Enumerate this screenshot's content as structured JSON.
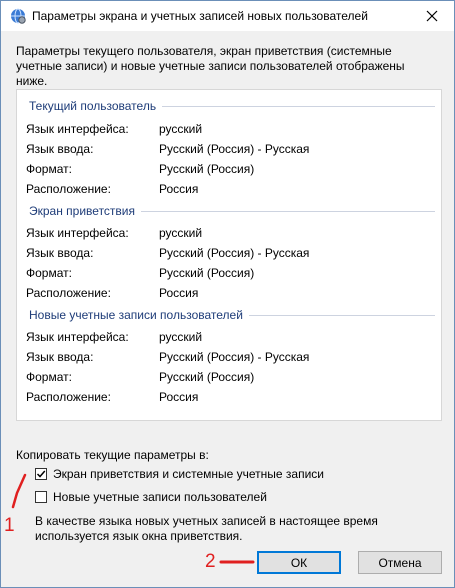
{
  "window": {
    "title": "Параметры экрана и учетных записей новых пользователей",
    "icon": "globe-settings-icon"
  },
  "intro": "Параметры текущего пользователя, экран приветствия (системные учетные записи) и новые учетные записи пользователей отображены ниже.",
  "groups": [
    {
      "title": "Текущий пользователь",
      "rows": [
        {
          "label": "Язык интерфейса:",
          "value": "русский"
        },
        {
          "label": "Язык ввода:",
          "value": "Русский (Россия) - Русская"
        },
        {
          "label": "Формат:",
          "value": "Русский (Россия)"
        },
        {
          "label": "Расположение:",
          "value": "Россия"
        }
      ]
    },
    {
      "title": "Экран приветствия",
      "rows": [
        {
          "label": "Язык интерфейса:",
          "value": "русский"
        },
        {
          "label": "Язык ввода:",
          "value": "Русский (Россия) - Русская"
        },
        {
          "label": "Формат:",
          "value": "Русский (Россия)"
        },
        {
          "label": "Расположение:",
          "value": "Россия"
        }
      ]
    },
    {
      "title": "Новые учетные записи пользователей",
      "rows": [
        {
          "label": "Язык интерфейса:",
          "value": "русский"
        },
        {
          "label": "Язык ввода:",
          "value": "Русский (Россия) - Русская"
        },
        {
          "label": "Формат:",
          "value": "Русский (Россия)"
        },
        {
          "label": "Расположение:",
          "value": "Россия"
        }
      ]
    }
  ],
  "copy": {
    "label": "Копировать текущие параметры в:",
    "welcome_screen": {
      "label": "Экран приветствия и системные учетные записи",
      "checked": true
    },
    "new_users": {
      "label": "Новые учетные записи пользователей",
      "checked": false
    }
  },
  "note": "В качестве языка новых учетных записей в настоящее время используется язык окна приветствия.",
  "buttons": {
    "ok": "ОК",
    "cancel": "Отмена"
  },
  "annotations": {
    "marker1": "1",
    "marker2": "2",
    "color": "#e02020"
  }
}
